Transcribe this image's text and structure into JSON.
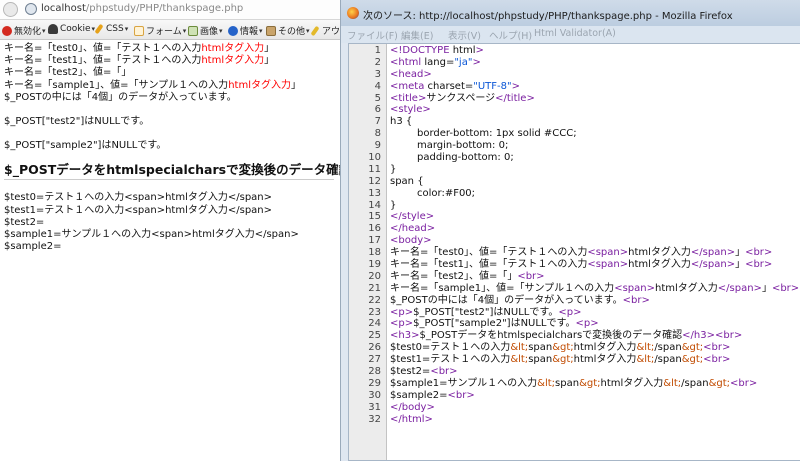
{
  "left": {
    "url_host": "localhost",
    "url_path": "/phpstudy/PHP/thankspage.php",
    "toolbar": [
      {
        "label": "無効化",
        "icon": "no-entry-icon",
        "color": "#d42a1f"
      },
      {
        "label": "Cookie",
        "icon": "person-icon",
        "color": "#3a3a3a"
      },
      {
        "label": "CSS",
        "icon": "pencil-icon",
        "color": "#e6a21a"
      },
      {
        "label": "フォーム",
        "icon": "form-icon",
        "color": "#d9a441"
      },
      {
        "label": "画像",
        "icon": "image-icon",
        "color": "#6c8c3c"
      },
      {
        "label": "情報",
        "icon": "info-icon",
        "color": "#2563c9"
      },
      {
        "label": "その他",
        "icon": "misc-icon",
        "color": "#8a6d3b"
      },
      {
        "label": "アウ",
        "icon": "outline-icon",
        "color": "#e3b92a"
      }
    ],
    "lines": [
      {
        "pre": "キー名=「test0」、値=「テスト１への入力",
        "red": "htmlタグ入力",
        "post": "」"
      },
      {
        "pre": "キー名=「test1」、値=「テスト１への入力",
        "red": "htmlタグ入力",
        "post": "」"
      },
      {
        "pre": "キー名=「test2」、値=「」",
        "red": "",
        "post": ""
      },
      {
        "pre": "キー名=「sample1」、値=「サンプル１への入力",
        "red": "htmlタグ入力",
        "post": "」"
      },
      {
        "pre": "$_POSTの中には「4個」のデータが入っています。",
        "red": "",
        "post": ""
      }
    ],
    "p1": "$_POST[\"test2\"]はNULLです。",
    "p2": "$_POST[\"sample2\"]はNULLです。",
    "heading": "$_POSTデータをhtmlspecialcharsで変換後のデータ確認",
    "after": [
      "$test0=テスト１への入力<span>htmlタグ入力</span>",
      "$test1=テスト１への入力<span>htmlタグ入力</span>",
      "$test2=",
      "$sample1=サンプル１への入力<span>htmlタグ入力</span>",
      "$sample2="
    ]
  },
  "source": {
    "title": "次のソース: http://localhost/phpstudy/PHP/thankspage.php - Mozilla Firefox",
    "menu": [
      "ファイル(F)",
      "編集(E)",
      "表示(V)",
      "ヘルプ(H)",
      "Html Validator(A)"
    ],
    "lines": [
      "<!DOCTYPE html>",
      "<html lang=\"ja\">",
      "<head>",
      "<meta charset=\"UTF-8\">",
      "<title>サンクスページ</title>",
      "<style>",
      "h3 {",
      "border-bottom: 1px solid #CCC;",
      "margin-bottom: 0;",
      "padding-bottom: 0;",
      "}",
      "span {",
      "color:#F00;",
      "}",
      "</style>",
      "</head>",
      "<body>",
      "キー名=「test0」、値=「テスト１への入力<span>htmlタグ入力</span>」<br>",
      "キー名=「test1」、値=「テスト１への入力<span>htmlタグ入力</span>」<br>",
      "キー名=「test2」、値=「」<br>",
      "キー名=「sample1」、値=「サンプル１への入力<span>htmlタグ入力</span>」<br>",
      "$_POSTの中には「4個」のデータが入っています。<br>",
      "<p>$_POST[\"test2\"]はNULLです。<p>",
      "<p>$_POST[\"sample2\"]はNULLです。<p>",
      "<h3>$_POSTデータをhtmlspecialcharsで変換後のデータ確認</h3><br>",
      "$test0=テスト１への入力&lt;span&gt;htmlタグ入力&lt;/span&gt;<br>",
      "$test1=テスト１への入力&lt;span&gt;htmlタグ入力&lt;/span&gt;<br>",
      "$test2=<br>",
      "$sample1=サンプル１への入力&lt;span&gt;htmlタグ入力&lt;/span&gt;<br>",
      "$sample2=<br>",
      "</body>",
      "</html>"
    ]
  }
}
